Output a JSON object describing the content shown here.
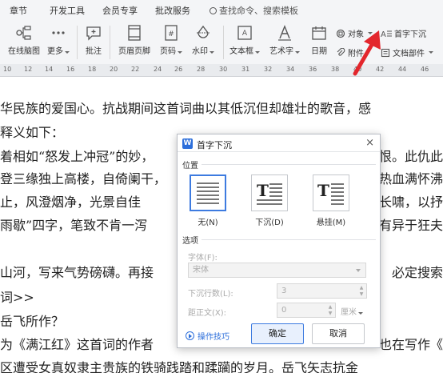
{
  "menu_tabs": [
    "章节",
    "开发工具",
    "会员专享",
    "批改服务"
  ],
  "search_placeholder": "查找命令、搜索模板",
  "ribbon": {
    "mindmap": "在线脑图",
    "more": "更多",
    "comment": "批注",
    "header_footer": "页眉页脚",
    "page_number": "页码",
    "watermark": "水印",
    "textbox": "文本框",
    "wordart": "艺术字",
    "date": "日期",
    "object": "对象",
    "attachment": "附件",
    "dropcap": "首字下沉",
    "doc_parts": "文档部件"
  },
  "ruler_numbers": [
    "10",
    "12",
    "14",
    "16",
    "18",
    "20",
    "22",
    "24",
    "26",
    "28",
    "30",
    "31",
    "32",
    "34",
    "36",
    "38",
    "40",
    "42",
    "44",
    "46"
  ],
  "doc_lines": [
    "华民族的爱国心。抗战期间这首词曲以其低沉但却雄壮的歌音，感",
    "释义如下：",
    "着相如“怒发上冲冠”的妙，",
    "登三缘独上高楼，自倚阑干，",
    "止，风澄烟净，光景自佳",
    "雨歇”四字，笔致不肯一泻",
    "",
    "山河，写来气势磅礴。再接",
    "词>>",
    "岳飞所作？",
    "为《满江红》这首词的作者",
    "区遭受女真奴隶主贵族的铁骑践踏和蹂躏的岁月。岳飞矢志抗金"
  ],
  "doc_right_fragments": {
    "l2": "恨。此仇此",
    "l3": "热血满怀沸",
    "l4": "长啸，以抒",
    "l5": "有异于狂夫",
    "l7": "必定搜索",
    "l10": "也在写作《"
  },
  "dialog": {
    "title": "首字下沉",
    "close": "×",
    "section_position": "位置",
    "options": [
      "无(N)",
      "下沉(D)",
      "悬挂(M)"
    ],
    "section_options": "选项",
    "font_label": "字体(F):",
    "font_value": "宋体",
    "lines_label": "下沉行数(L):",
    "lines_value": "3",
    "distance_label": "距正文(X):",
    "distance_value": "0",
    "distance_unit": "厘米",
    "tips": "操作技巧",
    "ok": "确定",
    "cancel": "取消"
  }
}
